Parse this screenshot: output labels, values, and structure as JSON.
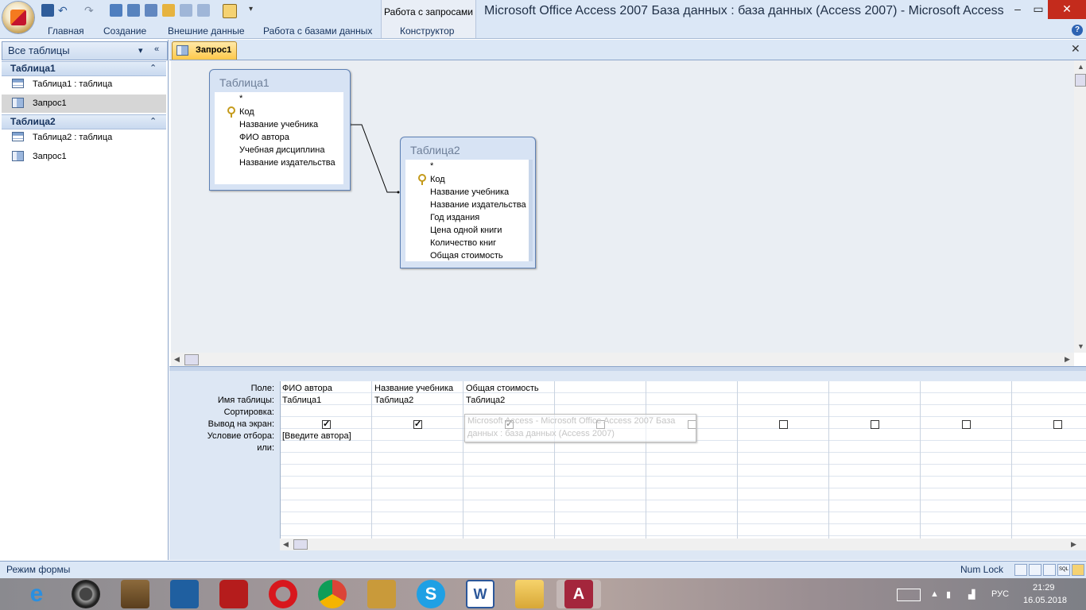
{
  "window": {
    "title": "Microsoft Office Access 2007 База данных : база данных (Access 2007) - Microsoft Access",
    "context_tab_group": "Работа с запросами",
    "controls": {
      "minimize": "–",
      "maximize": "▭",
      "close": "✕"
    }
  },
  "ribbon": {
    "tabs": [
      "Главная",
      "Создание",
      "Внешние данные",
      "Работа с базами данных",
      "Конструктор"
    ],
    "help": "?"
  },
  "nav": {
    "header": "Все таблицы",
    "header_icons": [
      "chevron-down-icon",
      "collapse-left-icon"
    ],
    "groups": [
      {
        "title": "Таблица1",
        "items": [
          {
            "label": "Таблица1 : таблица",
            "icon": "table-icon"
          },
          {
            "label": "Запрос1",
            "icon": "query-icon",
            "selected": true
          }
        ]
      },
      {
        "title": "Таблица2",
        "items": [
          {
            "label": "Таблица2 : таблица",
            "icon": "table-icon"
          },
          {
            "label": "Запрос1",
            "icon": "query-icon"
          }
        ]
      }
    ]
  },
  "document_tab": {
    "label": "Запрос1",
    "close": "✕"
  },
  "design": {
    "tables": [
      {
        "title": "Таблица1",
        "fields": [
          "*",
          "Код",
          "Название учебника",
          "ФИО автора",
          "Учебная дисциплина",
          "Название издательства"
        ],
        "key_field": "Код"
      },
      {
        "title": "Таблица2",
        "fields": [
          "*",
          "Код",
          "Название учебника",
          "Название издательства",
          "Год издания",
          "Цена одной книги",
          "Количество книг",
          "Общая стоимость"
        ],
        "key_field": "Код"
      }
    ],
    "relationship": {
      "from": "Таблица1.Название учебника",
      "to": "Таблица2.Код"
    }
  },
  "qbe": {
    "row_labels": [
      "Поле:",
      "Имя таблицы:",
      "Сортировка:",
      "Вывод на экран:",
      "Условие отбора:",
      "или:"
    ],
    "columns": [
      {
        "field": "ФИО автора",
        "table": "Таблица1",
        "show": true,
        "criteria": "[Введите автора]"
      },
      {
        "field": "Название учебника",
        "table": "Таблица2",
        "show": true,
        "criteria": ""
      },
      {
        "field": "Общая стоимость",
        "table": "Таблица2",
        "show": true,
        "criteria": ""
      },
      {
        "field": "",
        "table": "",
        "show": false,
        "criteria": ""
      },
      {
        "field": "",
        "table": "",
        "show": false,
        "criteria": ""
      },
      {
        "field": "",
        "table": "",
        "show": false,
        "criteria": ""
      },
      {
        "field": "",
        "table": "",
        "show": false,
        "criteria": ""
      },
      {
        "field": "",
        "table": "",
        "show": false,
        "criteria": ""
      },
      {
        "field": "",
        "table": "",
        "show": false,
        "criteria": ""
      }
    ],
    "tooltip": {
      "line1": "Microsoft Access - Microsoft Office Access 2007 База",
      "line2": "данных : база данных (Access 2007)"
    }
  },
  "status": {
    "mode": "Режим формы",
    "numlock": "Num Lock",
    "view_buttons": [
      "",
      "",
      "",
      "SQL",
      ""
    ]
  },
  "taskbar": {
    "apps": [
      "internet-explorer-icon",
      "speaker-app-icon",
      "doc-app-icon",
      "settings-app-icon",
      "power-app-icon",
      "opera-icon",
      "chrome-icon",
      "scanner-app-icon",
      "skype-icon",
      "word-icon",
      "explorer-icon",
      "access-icon"
    ],
    "lang": "РУС",
    "time": "21:29",
    "date": "16.05.2018"
  },
  "colors": {
    "ribbon_bg": "#dbe7f6",
    "doc_tab": "#ffc84a",
    "access_accent": "#a4263c"
  }
}
